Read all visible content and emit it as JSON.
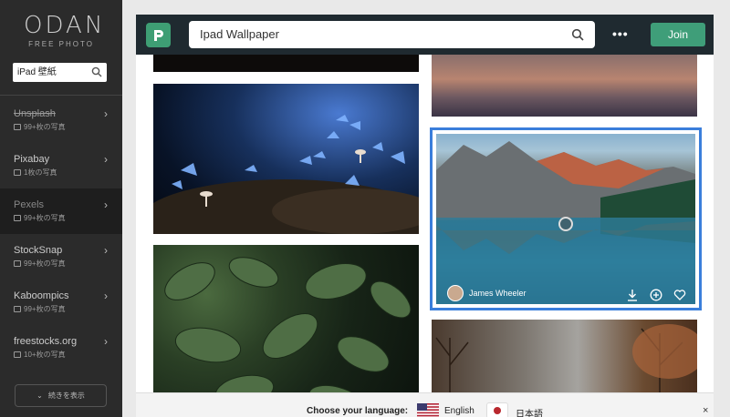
{
  "sidebar": {
    "logo_main": "ODAN",
    "logo_sub": "FREE PHOTO",
    "search_value": "iPad 壁紙",
    "sources": [
      {
        "name": "Unsplash",
        "count": "99+枚の写真"
      },
      {
        "name": "Pixabay",
        "count": "1枚の写真"
      },
      {
        "name": "Pexels",
        "count": "99+枚の写真"
      },
      {
        "name": "StockSnap",
        "count": "99+枚の写真"
      },
      {
        "name": "Kaboompics",
        "count": "99+枚の写真"
      },
      {
        "name": "freestocks.org",
        "count": "10+枚の写真"
      }
    ],
    "more_label": "続きを表示"
  },
  "header": {
    "search_value": "Ipad Wallpaper",
    "more_label": "•••",
    "join_label": "Join"
  },
  "photo_card": {
    "author": "James Wheeler"
  },
  "language_bar": {
    "prompt": "Choose your language:",
    "english": "English",
    "japanese": "日本語",
    "close": "×"
  },
  "colors": {
    "accent": "#3f9e79",
    "selection": "#3a7edb",
    "sidebar_bg": "#2b2b2b",
    "topbar_bg": "#1f2a30"
  }
}
